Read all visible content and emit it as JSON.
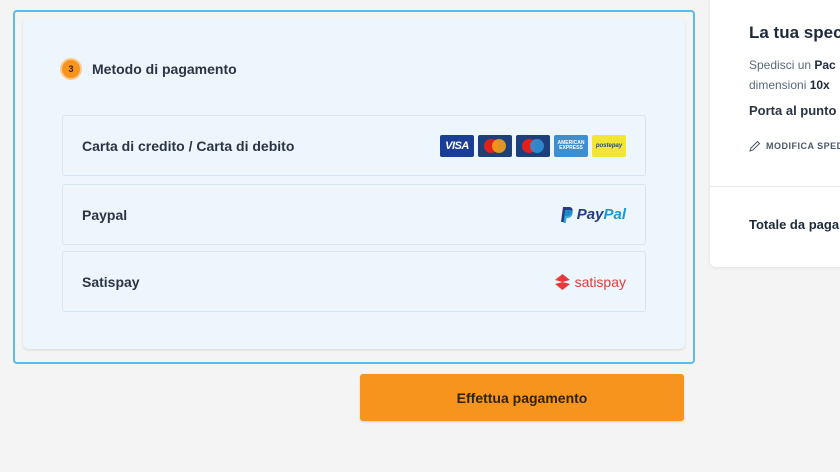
{
  "payment": {
    "step_number": "3",
    "title": "Metodo di pagamento",
    "methods": [
      {
        "label": "Carta di credito / Carta di debito",
        "logos": [
          "VISA",
          "MasterCard",
          "Maestro",
          "AMERICAN EXPRESS",
          "postepay"
        ]
      },
      {
        "label": "Paypal",
        "logo_part1": "Pay",
        "logo_part2": "Pal"
      },
      {
        "label": "Satispay",
        "logo_text": "satispay"
      }
    ],
    "submit_label": "Effettua pagamento"
  },
  "summary": {
    "title": "La tua spec",
    "line1_prefix": "Spedisci un ",
    "line1_bold": "Pac",
    "line2_prefix": "dimensioni ",
    "line2_bold": "10x",
    "destination": "Porta al punto",
    "edit_label": "MODIFICA SPED",
    "total_label": "Totale da paga"
  },
  "colors": {
    "accent": "#f7941d",
    "focus_border": "#5bbbe9",
    "panel_bg": "#edf6fc",
    "paypal_dark": "#263b80",
    "paypal_light": "#179bd7",
    "satispay": "#e5393c"
  }
}
